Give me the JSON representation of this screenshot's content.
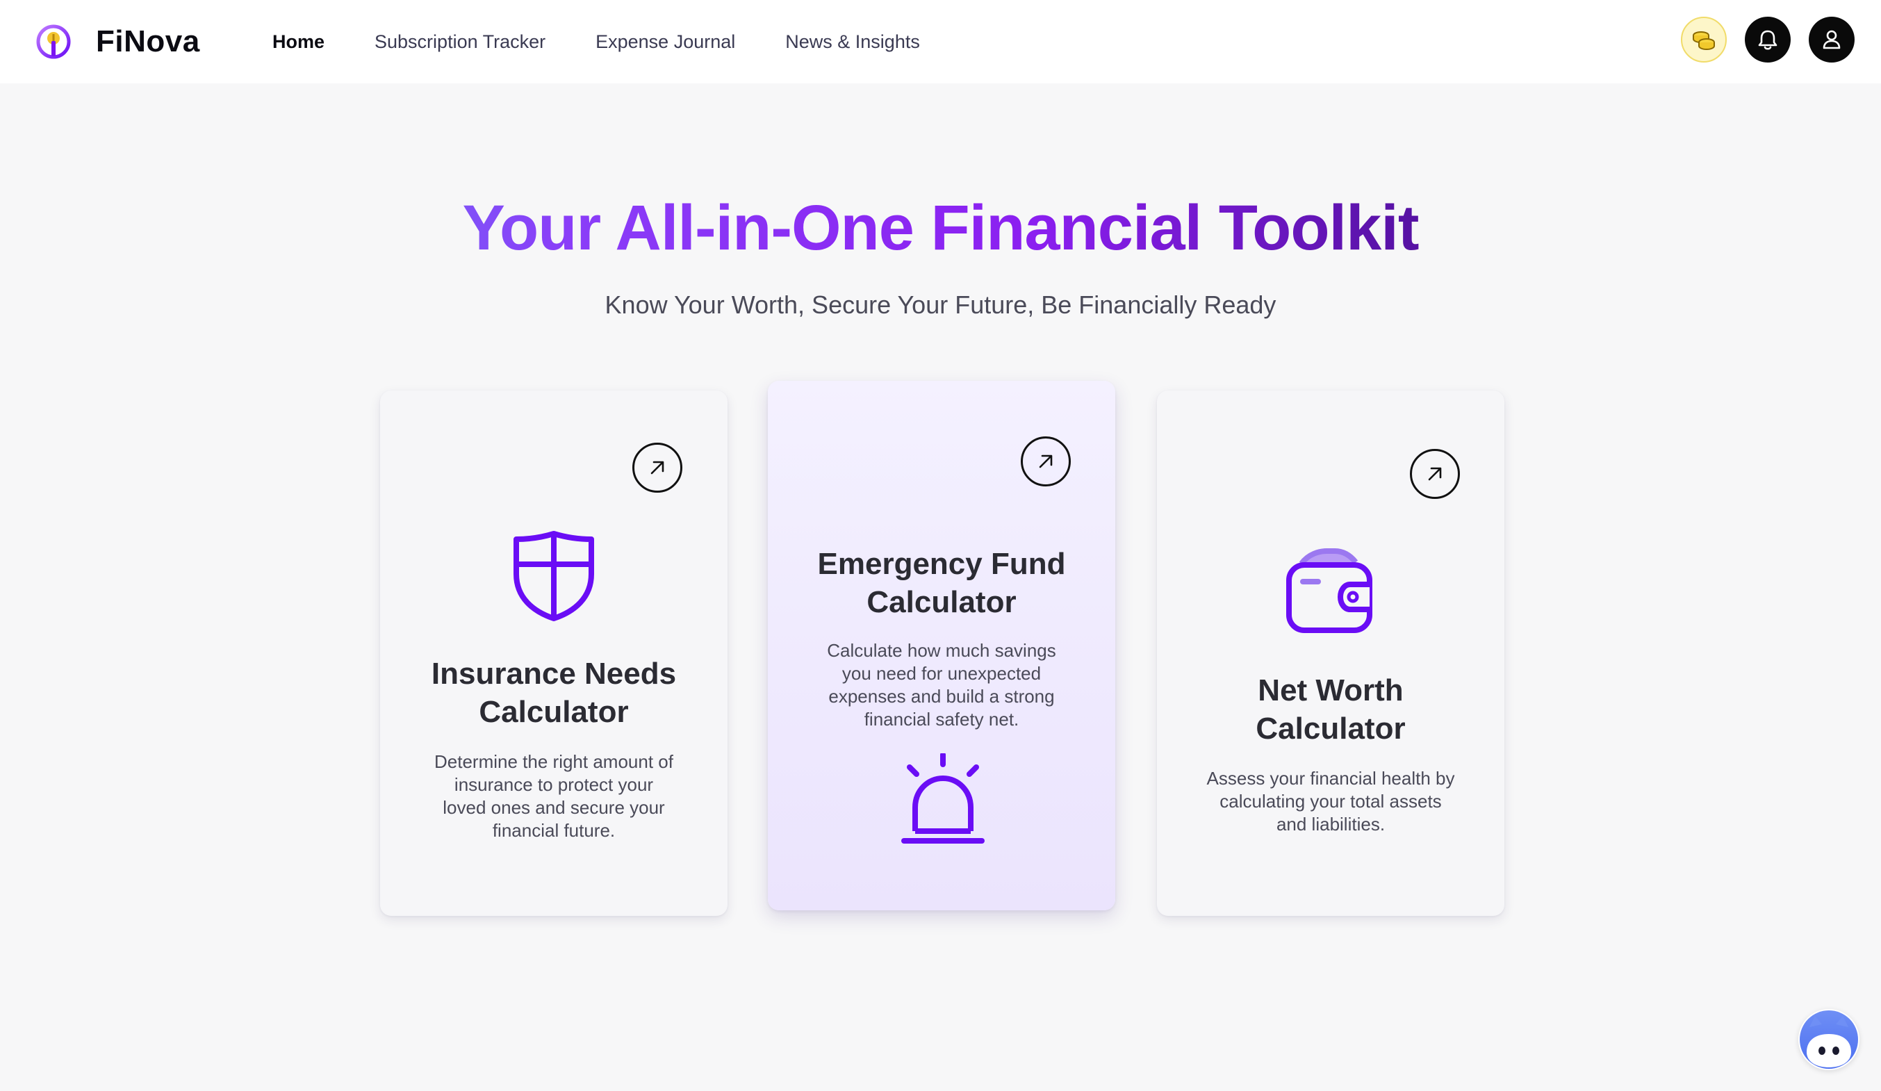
{
  "brand": {
    "name": "FiNova"
  },
  "nav": {
    "links": [
      {
        "label": "Home",
        "active": true
      },
      {
        "label": "Subscription Tracker",
        "active": false
      },
      {
        "label": "Expense Journal",
        "active": false
      },
      {
        "label": "News & Insights",
        "active": false
      }
    ],
    "icons": [
      "coins-icon",
      "bell-icon",
      "user-icon"
    ]
  },
  "hero": {
    "title": "Your All-in-One Financial Toolkit",
    "subtitle": "Know Your Worth, Secure Your Future, Be Financially Ready"
  },
  "cards": [
    {
      "title_line1": "Insurance Needs",
      "title_line2": "Calculator",
      "desc": [
        "Determine the right amount of",
        "insurance to protect your",
        "loved ones and secure your",
        "financial future."
      ],
      "icon": "shield-icon"
    },
    {
      "title_line1": "Emergency Fund",
      "title_line2": "Calculator",
      "desc": [
        "Calculate how much savings",
        "you need for unexpected",
        "expenses and build a strong",
        "financial safety net."
      ],
      "icon": "siren-icon"
    },
    {
      "title_line1": "Net Worth",
      "title_line2": "Calculator",
      "desc": [
        "Assess your financial health by",
        "calculating your total assets",
        "and liabilities."
      ],
      "icon": "wallet-icon"
    }
  ],
  "colors": {
    "accent": "#6a0df5",
    "title_gradient": [
      "#5aa4f7",
      "#8a3ef8",
      "#8b1ff0",
      "#3d0b7e",
      "#2a0659"
    ],
    "highlight_card": "#ebe4fd"
  }
}
